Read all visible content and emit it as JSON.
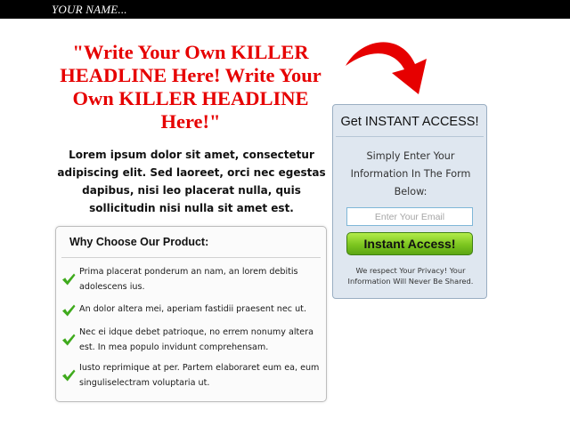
{
  "topbar": {
    "name": "YOUR NAME..."
  },
  "headline": "\"Write Your Own KILLER HEADLINE Here! Write Your Own KILLER HEADLINE Here!\"",
  "intro": "Lorem ipsum dolor sit amet, consectetur adipiscing elit. Sed laoreet, orci nec egestas dapibus, nisi leo placerat nulla, quis sollicitudin nisi nulla sit amet est.",
  "features": {
    "title": "Why Choose Our Product:",
    "items": [
      {
        "text": "Prima placerat ponderum an nam, an lorem debitis adolescens ius."
      },
      {
        "text": "An dolor altera mei, aperiam fastidii praesent nec ut."
      },
      {
        "text": "Nec ei idque debet patrioque, no errem nonumy altera est. In mea populo invidunt comprehensam."
      },
      {
        "text": "Iusto reprimique at per. Partem elaboraret eum ea, eum singuliselectram voluptaria ut."
      }
    ]
  },
  "optin": {
    "title": "Get INSTANT ACCESS!",
    "description": "Simply Enter Your Information In The Form Below:",
    "email_placeholder": "Enter Your Email",
    "button_label": "Instant Access!",
    "privacy": "We respect Your Privacy! Your Information Will Never Be Shared."
  },
  "colors": {
    "headline": "#e60000",
    "arrow": "#e60000",
    "checkmark": "#3faa1d",
    "button": "#7cc51f",
    "optin_bg": "#dfe7f0",
    "topbar": "#000000"
  },
  "icons": {
    "arrow": "curved-arrow-icon",
    "check": "checkmark-icon"
  }
}
